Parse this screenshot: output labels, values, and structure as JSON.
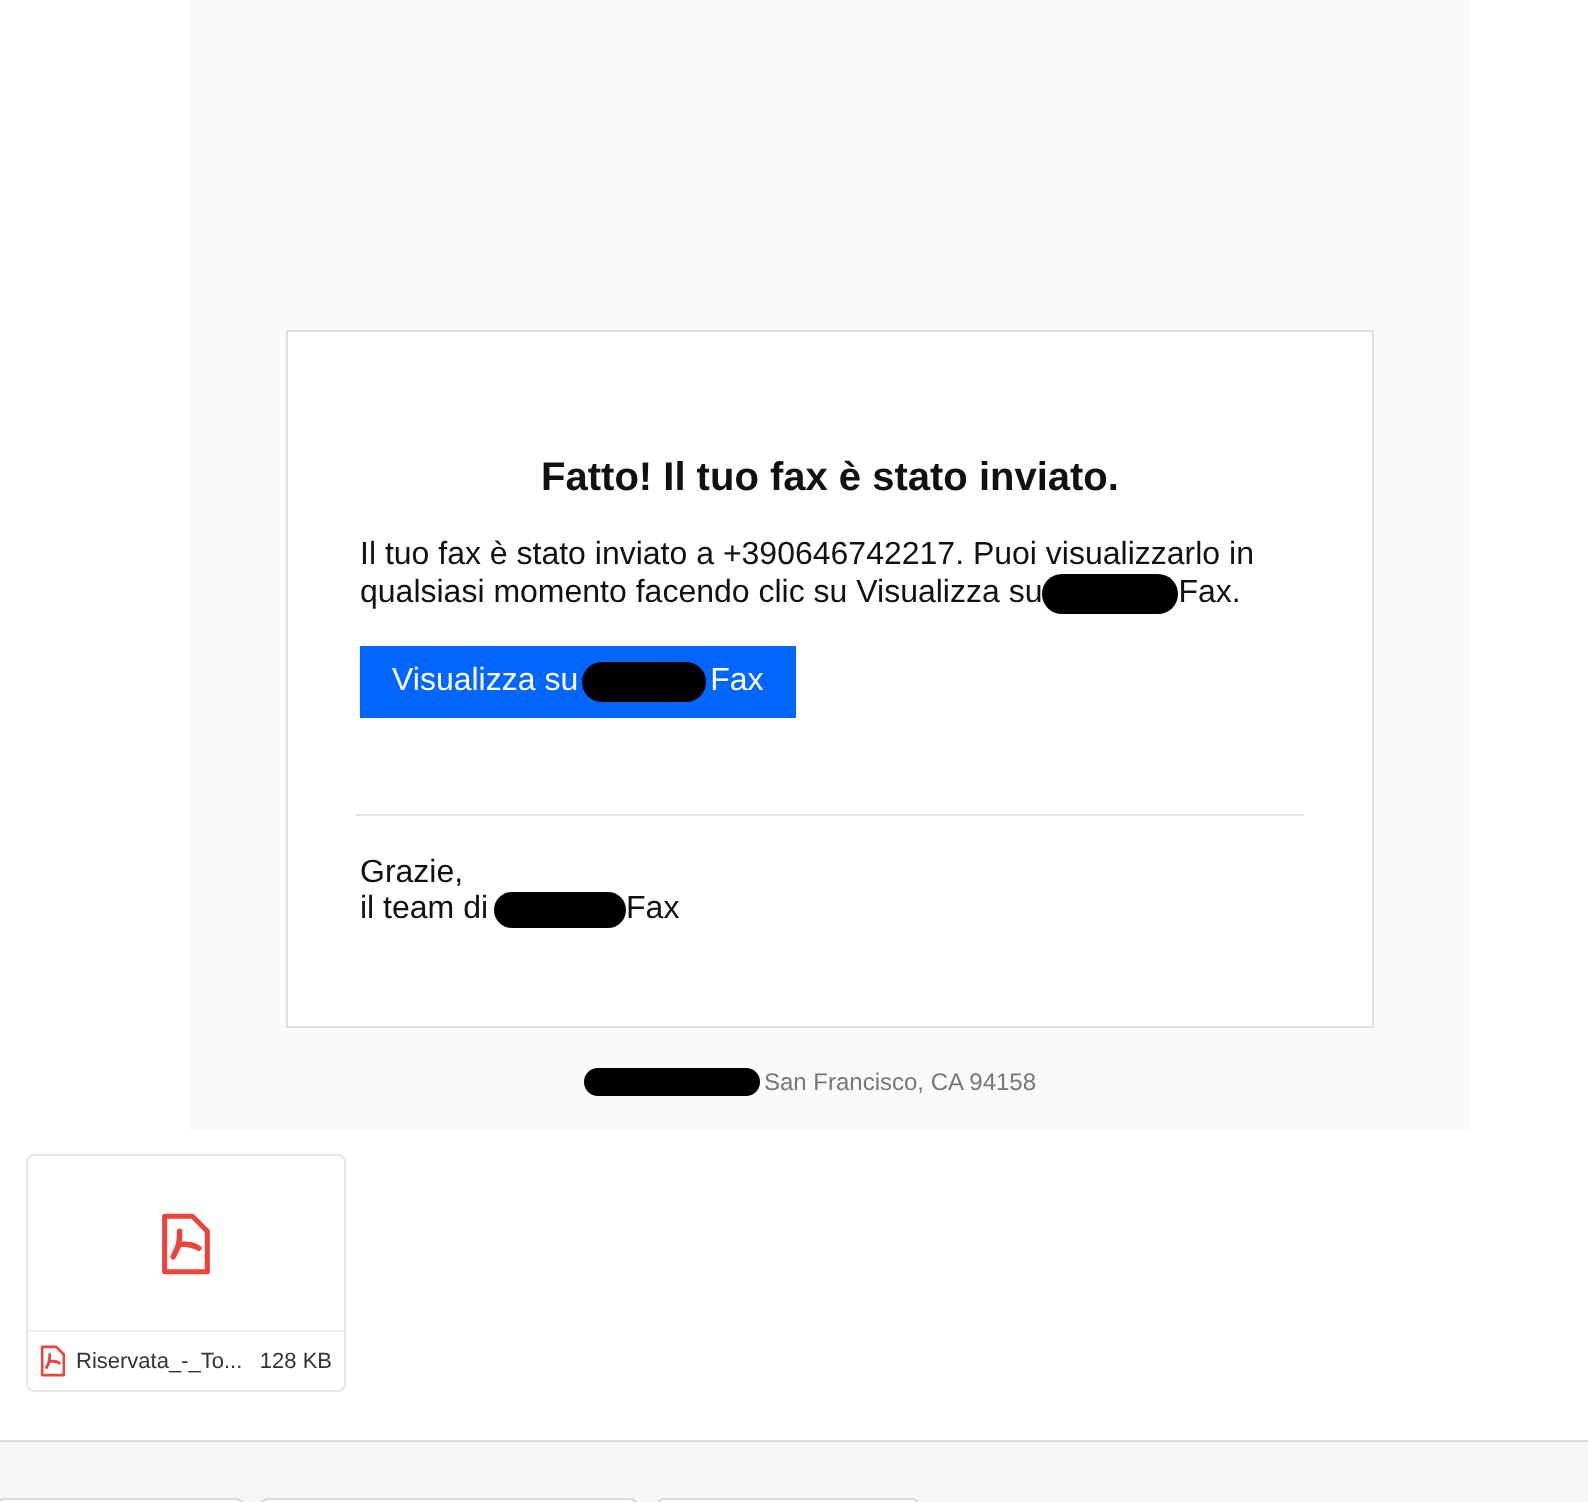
{
  "email": {
    "heading": "Fatto! Il tuo fax è stato inviato.",
    "body": {
      "line1": "Il tuo fax è stato inviato a +390646742217. Puoi visualizzarlo in",
      "before": "qualsiasi momento facendo clic su Visualizza su",
      "after": "Fax."
    },
    "button": {
      "before": "Visualizza su",
      "after": "Fax"
    },
    "signoff": {
      "line1": "Grazie,",
      "before": "il team di",
      "after": "Fax"
    },
    "footer": {
      "address": "San Francisco, CA 94158"
    }
  },
  "attachments": [
    {
      "name": "Riservata_-_To...",
      "size": "128 KB"
    }
  ]
}
